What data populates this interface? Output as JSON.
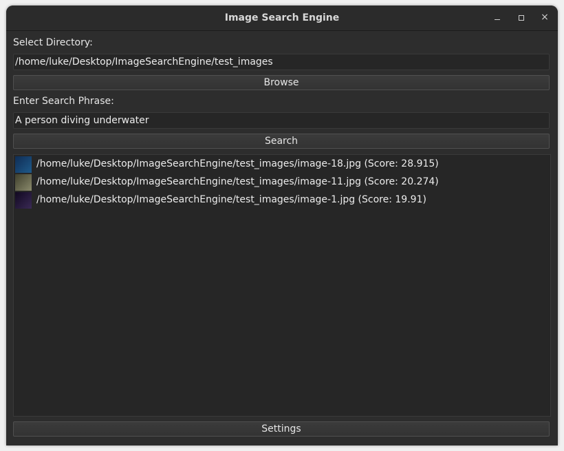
{
  "window": {
    "title": "Image Search Engine",
    "controls": {
      "minimize": "minimize",
      "maximize": "maximize",
      "close": "×"
    }
  },
  "directory": {
    "label": "Select Directory:",
    "value": "/home/luke/Desktop/ImageSearchEngine/test_images",
    "browse_label": "Browse"
  },
  "search": {
    "label": "Enter Search Phrase:",
    "value": "A person diving underwater",
    "button_label": "Search"
  },
  "results": [
    {
      "text": "/home/luke/Desktop/ImageSearchEngine/test_images/image-18.jpg (Score: 28.915)",
      "thumb_colors": [
        "#0f2c54",
        "#1f5a8a"
      ]
    },
    {
      "text": "/home/luke/Desktop/ImageSearchEngine/test_images/image-11.jpg (Score: 20.274)",
      "thumb_colors": [
        "#3f3f2c",
        "#8a8a6c"
      ]
    },
    {
      "text": "/home/luke/Desktop/ImageSearchEngine/test_images/image-1.jpg (Score: 19.91)",
      "thumb_colors": [
        "#110820",
        "#3a2a55"
      ]
    }
  ],
  "footer": {
    "settings_label": "Settings"
  },
  "colors": {
    "window_bg": "#2d2d2d",
    "field_bg": "#262626",
    "text": "#ececec"
  }
}
